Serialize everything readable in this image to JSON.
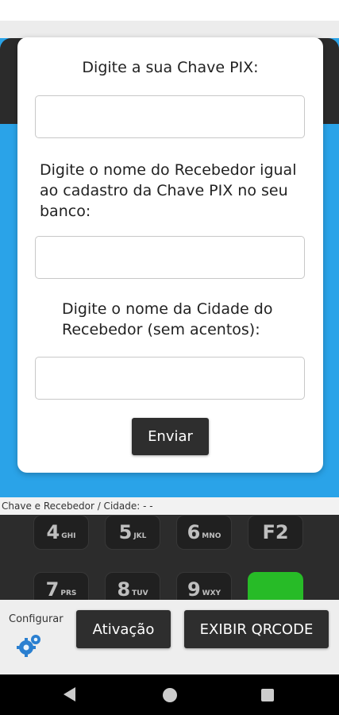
{
  "dialog": {
    "pix_key_prompt": "Digite a sua Chave PIX:",
    "pix_key_value": "",
    "receiver_name_prompt": "Digite o nome do Recebedor igual ao cadastro da Chave PIX no seu banco:",
    "receiver_name_value": "",
    "city_prompt": "Digite o nome da Cidade do Recebedor (sem acentos):",
    "city_value": "",
    "send_label": "Enviar"
  },
  "info_line": "Chave e Recebedor / Cidade:  -  -",
  "keypad": {
    "keys": [
      {
        "digit": "4",
        "letters": "GHI"
      },
      {
        "digit": "5",
        "letters": "JKL"
      },
      {
        "digit": "6",
        "letters": "MNO"
      },
      {
        "digit": "F2",
        "letters": ""
      },
      {
        "digit": "7",
        "letters": "PRS"
      },
      {
        "digit": "8",
        "letters": "TUV"
      },
      {
        "digit": "9",
        "letters": "WXY"
      }
    ]
  },
  "bottom": {
    "config_label": "Configurar",
    "activation_label": "Ativação",
    "show_qr_label": "EXIBIR QRCODE"
  },
  "colors": {
    "background_blue": "#2aa3e8",
    "button_dark": "#2e2e2e",
    "confirm_key_green": "#27d427"
  },
  "icons": {
    "config": "gears-icon",
    "nav_back": "triangle-back-icon",
    "nav_home": "circle-home-icon",
    "nav_recent": "square-recents-icon"
  }
}
